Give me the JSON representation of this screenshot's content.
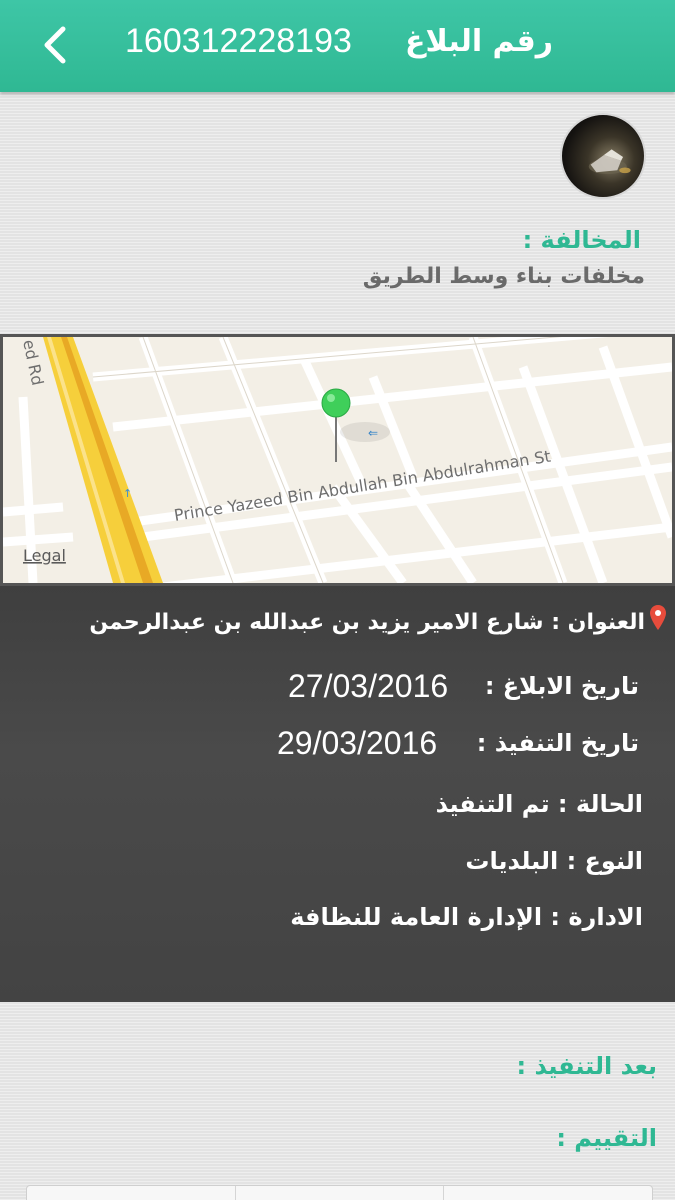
{
  "header": {
    "title": "رقم البلاغ",
    "report_number": "160312228193",
    "back_icon": "chevron-left-icon",
    "color": "#33bb96"
  },
  "violation": {
    "label": "المخالفة :",
    "value": "مخلفات بناء وسط الطريق"
  },
  "map": {
    "street_label": "Prince Yazeed Bin Abdullah Bin Abdulrahman St",
    "road_label": "ed Rd",
    "legal_label": "Legal",
    "pin_color": "#3fcf5a"
  },
  "details": {
    "address": "العنوان : شارع الامير يزيد بن عبدالله بن عبدالرحمن",
    "report_date_label": "تاريخ الابلاغ :",
    "report_date": "27/03/2016",
    "execution_date_label": "تاريخ التنفيذ :",
    "execution_date": "29/03/2016",
    "status": "الحالة : تم التنفيذ",
    "type": "النوع : البلديات",
    "department": "الادارة : الإدارة العامة للنظافة"
  },
  "after_execution": {
    "label": "بعد التنفيذ :"
  },
  "rating": {
    "label": "التقييم :"
  }
}
